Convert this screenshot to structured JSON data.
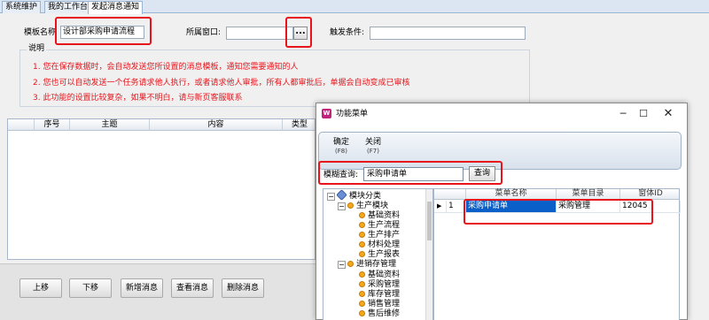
{
  "tabs": [
    "系统维护",
    "我的工作台",
    "发起消息通知"
  ],
  "form": {
    "template_label": "模板名称",
    "template_value": "设计部采购申请流程",
    "window_label": "所属窗口:",
    "window_value": "",
    "browse_label": "...",
    "trigger_label": "触发条件:",
    "trigger_value": ""
  },
  "description": {
    "title": "说明",
    "lines": [
      "1. 您在保存数据时，会自动发送您所设置的消息模板，通知您需要通知的人",
      "2. 您也可以自动发送一个任务请求他人执行，或者请求他人审批，所有人都审批后，单据会自动变成已审核",
      "3. 此功能的设置比较复杂，如果不明白，请与新页客服联系"
    ]
  },
  "main_grid": {
    "columns": [
      "序号",
      "主题",
      "内容",
      "类型"
    ]
  },
  "bottom_buttons": [
    "上移",
    "下移",
    "新增消息",
    "查看消息",
    "删除消息"
  ],
  "dialog": {
    "title": "功能菜单",
    "toolbar": [
      {
        "label": "确定",
        "hotkey": "(F8)"
      },
      {
        "label": "关闭",
        "hotkey": "(F7)"
      }
    ],
    "search_label": "模糊查询:",
    "search_value": "采购申请单",
    "search_button": "查询",
    "tree": [
      {
        "label": "模块分类",
        "level": 0,
        "toggle": "−"
      },
      {
        "label": "生产模块",
        "level": 1,
        "toggle": "−"
      },
      {
        "label": "基础资料",
        "level": 2
      },
      {
        "label": "生产流程",
        "level": 2
      },
      {
        "label": "生产排产",
        "level": 2
      },
      {
        "label": "材料处理",
        "level": 2
      },
      {
        "label": "生产报表",
        "level": 2
      },
      {
        "label": "进销存管理",
        "level": 1,
        "toggle": "−"
      },
      {
        "label": "基础资料",
        "level": 2
      },
      {
        "label": "采购管理",
        "level": 2
      },
      {
        "label": "库存管理",
        "level": 2
      },
      {
        "label": "销售管理",
        "level": 2
      },
      {
        "label": "售后维修",
        "level": 2
      }
    ],
    "list": {
      "columns": [
        "菜单名称",
        "菜单目录",
        "窗体ID"
      ],
      "rows": [
        {
          "indicator": "▶",
          "index": "1",
          "name": "采购申请单",
          "menu": "采购管理",
          "form_id": "12045"
        }
      ]
    }
  },
  "colors": {
    "highlight_red": "#e8141b",
    "selection_blue": "#0a60c8"
  }
}
